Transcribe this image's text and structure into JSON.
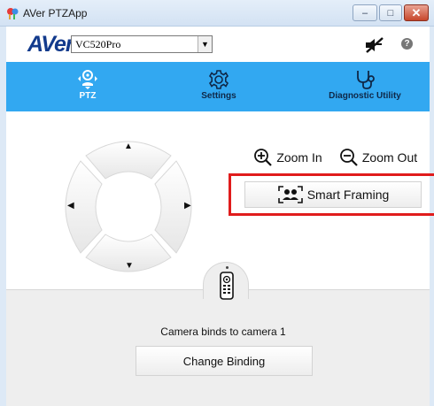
{
  "window": {
    "title": "AVer PTZApp",
    "controls": {
      "minimize": "–",
      "maximize": "□",
      "close": "✕"
    }
  },
  "header": {
    "logo": "AVer",
    "camera_select": {
      "selected": "VC520Pro"
    },
    "icons": [
      "mute-mic-icon",
      "help-icon"
    ],
    "help_glyph": "?"
  },
  "tabs": [
    {
      "label": "PTZ",
      "icon": "ptz-camera-icon",
      "active": true
    },
    {
      "label": "Settings",
      "icon": "gear-icon",
      "active": false
    },
    {
      "label": "Diagnostic Utility",
      "icon": "stethoscope-icon",
      "active": false
    }
  ],
  "ptz": {
    "direction_glyphs": {
      "up": "▲",
      "down": "▼",
      "left": "◀",
      "right": "▶"
    },
    "zoom_in_label": "Zoom In",
    "zoom_out_label": "Zoom Out",
    "smart_framing_label": "Smart Framing"
  },
  "binding": {
    "status_text": "Camera binds to camera 1",
    "change_label": "Change Binding"
  },
  "colors": {
    "accent": "#32a8f1",
    "logo": "#123a8c",
    "highlight": "#e01c1c",
    "lower_panel": "#eeeeee"
  }
}
